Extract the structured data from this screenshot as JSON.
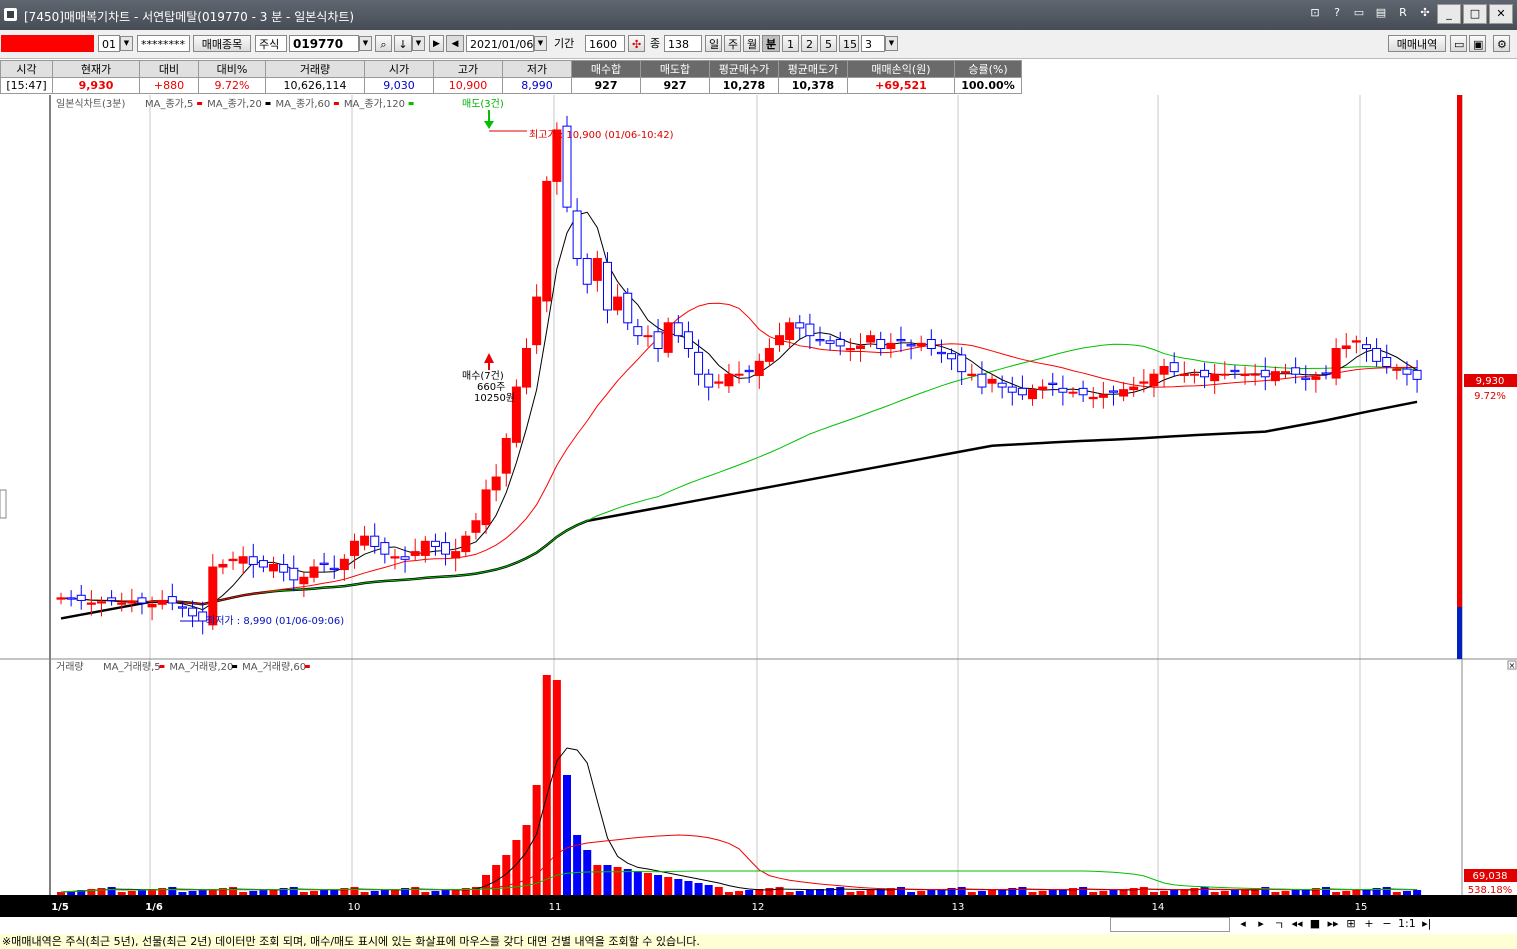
{
  "window": {
    "title": "[7450]매매복기차트 - 서연탑메탈(019770 - 3 분 - 일본식차트)"
  },
  "title_buttons": [
    "?",
    "?",
    "⊡",
    "ㅌ",
    "R",
    "⊗"
  ],
  "toolbar": {
    "account_no": "01",
    "password": "********",
    "trade_item_button": "매매종목",
    "market": "주식",
    "code": "019770",
    "date": "2021/01/06",
    "period_label": "기간",
    "period": "1600",
    "count_label": "종",
    "count": "138",
    "tf_day": "일",
    "tf_week": "주",
    "tf_month": "월",
    "tf_min": "분",
    "tf_1": "1",
    "tf_2": "2",
    "tf_5": "5",
    "tf_15": "15",
    "tf_sel": "3",
    "trade_history_button": "매매내역"
  },
  "quote": {
    "headers": [
      "시각",
      "현재가",
      "대비",
      "대비%",
      "거래량",
      "시가",
      "고가",
      "저가",
      "매수합",
      "매도합",
      "평균매수가",
      "평균매도가",
      "매매손익(원)",
      "승률(%)"
    ],
    "values": [
      "[15:47]",
      "9,930",
      "+880",
      "9.72%",
      "10,626,114",
      "9,030",
      "10,900",
      "8,990",
      "927",
      "927",
      "10,278",
      "10,378",
      "+69,521",
      "100.00%"
    ]
  },
  "chart": {
    "legend": "일본식차트(3분)",
    "ma_labels": [
      "MA_종가,5",
      "MA_종가,20",
      "MA_종가,60",
      "MA_종가,120"
    ],
    "sell_marker": "매도(3건)",
    "buy_marker": "매수(7건)",
    "buy_qty": "660주",
    "buy_price": "10250원",
    "high_label": "최고가 : 10,900 (01/06-10:42)",
    "low_label": "최저가 : 8,990 (01/06-09:06)",
    "price_tag": "9,930",
    "pct_tag": "9.72%"
  },
  "volume": {
    "legend": "거래량",
    "ma_labels": [
      "MA_거래량,5",
      "MA_거래량,20",
      "MA_거래량,60"
    ],
    "value_tag": "69,038",
    "pct_tag": "538.18%"
  },
  "x_axis": [
    "1/5",
    "1/6",
    "10",
    "11",
    "12",
    "13",
    "14",
    "15"
  ],
  "bottom_controls": [
    "◂",
    "▸",
    "ㄱ",
    "◂◂",
    "■",
    "▸▸",
    "⊞",
    "+",
    "−",
    "1:1",
    "▸|"
  ],
  "status_text": "※매매내역은 주식(최근 5년), 선물(최근 2년) 데이터만 조회 되며, 매수/매도 표시에 있는 화살표에 마우스를 갖다 대면 건별 내역을 조회할 수 있습니다.",
  "colors": {
    "up": "#ff0000",
    "down": "#0000ff",
    "ma5": "#000000",
    "ma20": "#ff0000",
    "ma60": "#00c000",
    "ma120": "#000000",
    "grid": "#c8c8c8"
  }
}
